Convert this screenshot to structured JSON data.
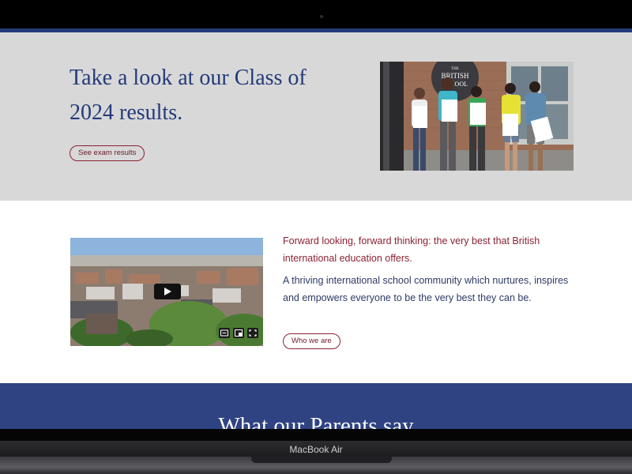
{
  "results": {
    "title": "Take a look at our Class of 2024 results.",
    "button_label": "See exam results",
    "photo_sign": [
      "THE",
      "BRITISH",
      "SCHOOL"
    ]
  },
  "about": {
    "lead": "Forward looking, forward thinking: the very best that British international education offers.",
    "body": "A thriving international school community which nurtures, inspires and empowers everyone to be the very best they can be.",
    "button_label": "Who we are",
    "video_controls": [
      "closed-captions-icon",
      "picture-in-picture-icon",
      "fullscreen-icon"
    ]
  },
  "parents": {
    "title": "What our Parents say"
  },
  "device": {
    "label": "MacBook Air"
  },
  "colors": {
    "navy": "#243a7a",
    "maroon": "#8a2232",
    "section_gray": "#d8d8d8",
    "parents_blue": "#2f4383"
  }
}
